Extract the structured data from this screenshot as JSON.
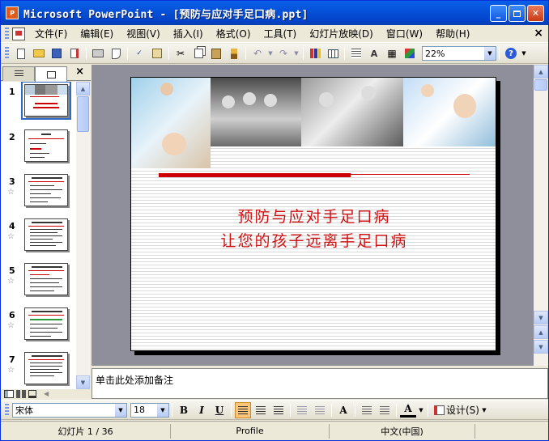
{
  "window": {
    "title": "Microsoft PowerPoint - [预防与应对手足口病.ppt]",
    "app_icon_label": "P",
    "colors": {
      "titlebar": "#0a5fe8",
      "close_button": "#c83a14",
      "slide_title": "#d01010",
      "slide_rule": "#cc0000"
    }
  },
  "menu": {
    "items": [
      "文件(F)",
      "编辑(E)",
      "视图(V)",
      "插入(I)",
      "格式(O)",
      "工具(T)",
      "幻灯片放映(D)",
      "窗口(W)",
      "帮助(H)"
    ],
    "close_glyph": "×"
  },
  "toolbar": {
    "zoom": "22%",
    "icons": [
      "new-icon",
      "open-icon",
      "save-icon",
      "permission-icon",
      "print-icon",
      "print-preview-icon",
      "spelling-icon",
      "research-icon",
      "cut-icon",
      "copy-icon",
      "paste-icon",
      "format-painter-icon",
      "undo-icon",
      "redo-icon",
      "insert-chart-icon",
      "insert-table-icon",
      "expand-all-icon",
      "show-formatting-icon",
      "show-grid-icon",
      "color-grayscale-icon",
      "help-icon"
    ]
  },
  "left_panel": {
    "close_glyph": "×",
    "slides": [
      {
        "number": "1"
      },
      {
        "number": "2"
      },
      {
        "number": "3"
      },
      {
        "number": "4"
      },
      {
        "number": "5"
      },
      {
        "number": "6"
      },
      {
        "number": "7"
      }
    ],
    "transition_glyph": "☆"
  },
  "slide": {
    "title_line1": "预防与应对手足口病",
    "title_line2": "让您的孩子远离手足口病"
  },
  "notes": {
    "placeholder": "单击此处添加备注"
  },
  "format_toolbar": {
    "font_name": "宋体",
    "font_size": "18",
    "bold": "B",
    "italic": "I",
    "underline": "U",
    "font_color_glyph": "A",
    "grow_font_glyph": "A",
    "design_label": "设计(S)"
  },
  "status": {
    "slide_counter": "幻灯片 1 / 36",
    "design_template": "Profile",
    "language": "中文(中国)"
  }
}
